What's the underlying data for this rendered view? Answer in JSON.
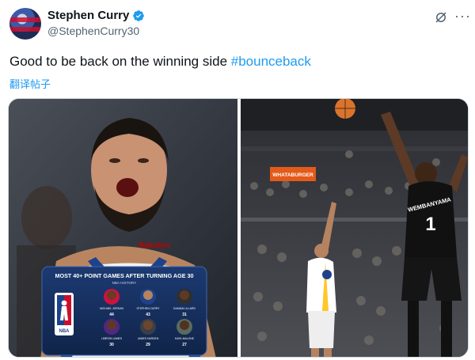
{
  "author": {
    "display_name": "Stephen Curry",
    "handle": "@StephenCurry30"
  },
  "icons": {
    "verified": "verified-badge-icon",
    "grok": "grok-icon",
    "more": "more-options-icon"
  },
  "tweet": {
    "text": "Good to be back on the winning side ",
    "hashtag": "#bounceback",
    "translate_label": "翻译帖子"
  },
  "image_left": {
    "jersey_sponsor": "Rakuten",
    "graphic": {
      "title": "MOST 40+ POINT GAMES AFTER TURNING AGE 30",
      "subtitle": "NBA HISTORY",
      "logo_text": "NBA",
      "players": [
        {
          "name": "MICHAEL JORDAN",
          "value": "44"
        },
        {
          "name": "STEPHEN CURRY",
          "value": "43"
        },
        {
          "name": "DAMIAN LILLARD",
          "value": "31"
        },
        {
          "name": "LEBRON JAMES",
          "value": "30"
        },
        {
          "name": "JAMES HARDEN",
          "value": "29"
        },
        {
          "name": "KARL MALONE",
          "value": "27"
        }
      ]
    }
  },
  "image_right": {
    "banner_text": "WHATABURGER",
    "jersey_name": "WEMBANYAMA",
    "jersey_number": "1"
  },
  "colors": {
    "accent_blue": "#1d9bf0",
    "warriors_blue": "#1d428a",
    "warriors_gold": "#ffc72c",
    "spurs_black": "#111111",
    "graphic_navy": "#16305e"
  }
}
